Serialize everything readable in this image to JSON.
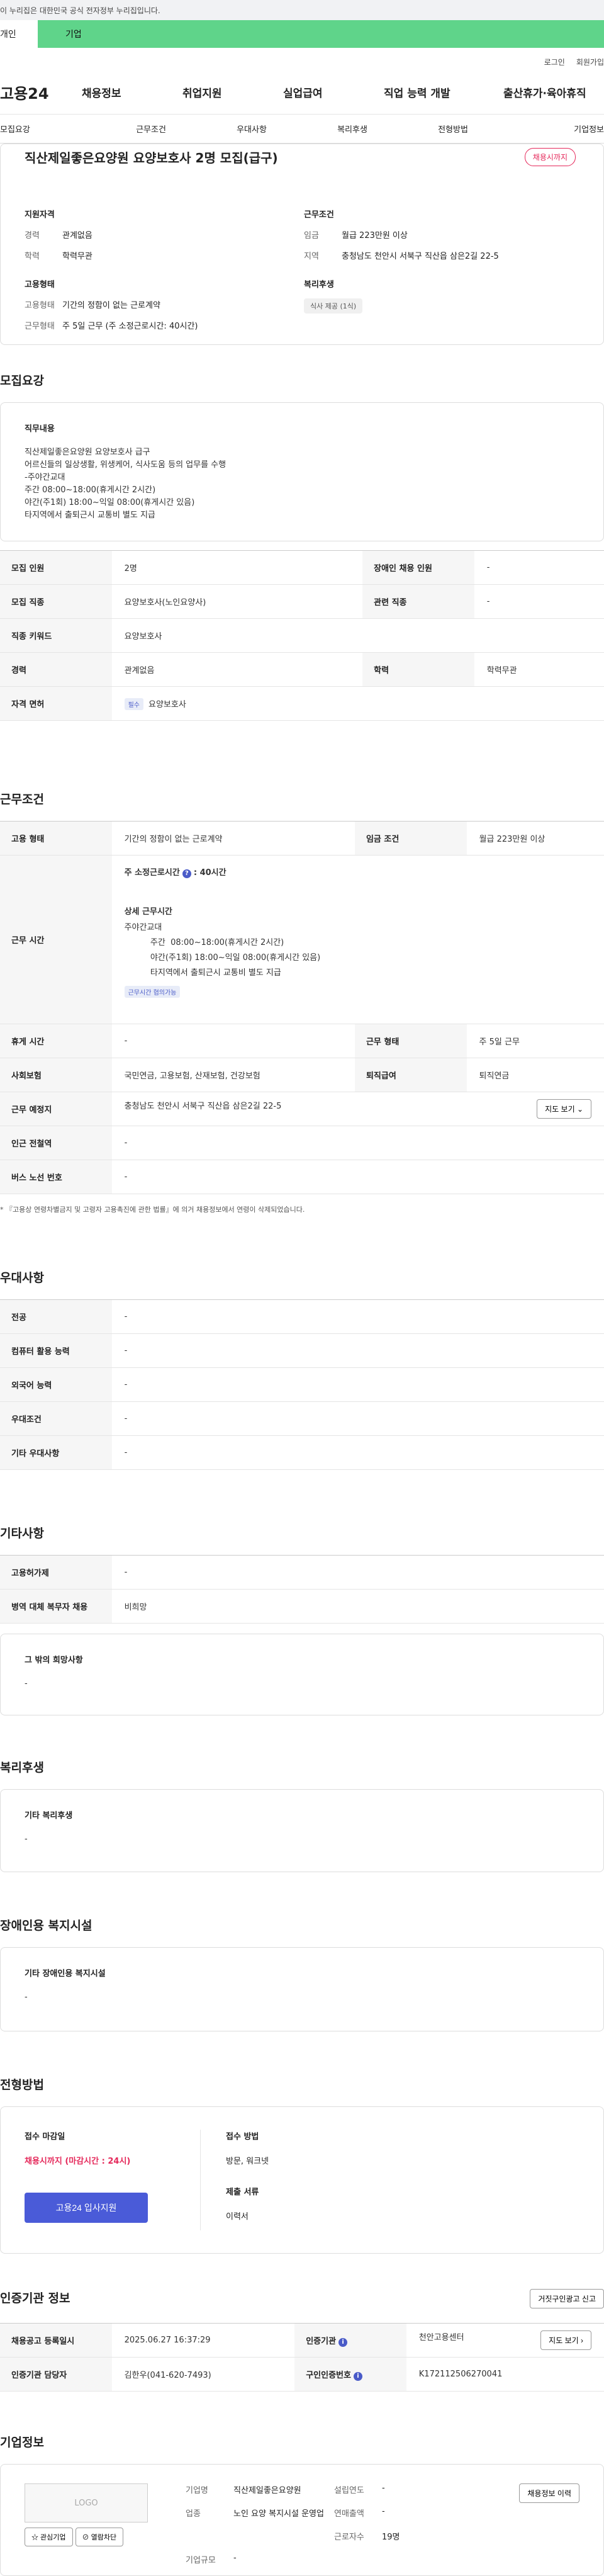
{
  "gov_banner": "이 누리집은 대한민국 공식 전자정부 누리집입니다.",
  "tabs": {
    "personal": "개인",
    "company": "기업"
  },
  "util": {
    "login": "로그인",
    "signup": "회원가입"
  },
  "logo": "고용24",
  "gnb": [
    "채용정보",
    "취업지원",
    "실업급여",
    "직업 능력 개발",
    "출산휴가·육아휴직"
  ],
  "anchor_nav": [
    "모집요강",
    "근무조건",
    "우대사항",
    "복리후생",
    "전형방법",
    "기업정보"
  ],
  "summary": {
    "title": "직산제일좋은요양원 요양보호사 2명 모집(급구)",
    "deadline_badge": "채용시까지",
    "qual_head": "지원자격",
    "career_k": "경력",
    "career_v": "관계없음",
    "edu_k": "학력",
    "edu_v": "학력무관",
    "cond_head": "근무조건",
    "wage_k": "임금",
    "wage_v": "월급 223만원 이상",
    "region_k": "지역",
    "region_v": "충청남도 천안시 서북구 직산읍 삼은2길 22-5",
    "emp_head": "고용형태",
    "emp_type_k": "고용형태",
    "emp_type_v": "기간의 정함이 없는 근로계약",
    "work_k": "근무형태",
    "work_v": "주 5일 근무 (주 소정근로시간: 40시간)",
    "benefit_head": "복리후생",
    "benefit_chip": "식사 제공 (1식)"
  },
  "recruit": {
    "title": "모집요강",
    "duty_head": "직무내용",
    "duty_text": "직산제일좋은요양원  요양보호사 급구\n 어르신들의 일상생활, 위생케어, 식사도움 등의 업무를 수행\n  -주야간교대\n  주간  08:00~18:00(휴게시간 2시간)\n  야간(주1회) 18:00~익일 08:00(휴게시간 있음)\n  타지역에서 출퇴근시 교통비 별도 지급",
    "rows": {
      "count_k": "모집 인원",
      "count_v": "2명",
      "disabled_k": "장애인 채용 인원",
      "disabled_v": "-",
      "job_k": "모집 직종",
      "job_v": "요양보호사(노인요양사)",
      "related_k": "관련 직종",
      "related_v": "-",
      "keyword_k": "직종 키워드",
      "keyword_v": "요양보호사",
      "career_k": "경력",
      "career_v": "관계없음",
      "edu_k": "학력",
      "edu_v": "학력무관",
      "license_k": "자격 면허",
      "license_badge": "필수",
      "license_v": "요양보호사"
    }
  },
  "conditions": {
    "title": "근무조건",
    "emp_k": "고용 형태",
    "emp_v": "기간의 정함이 없는 근로계약",
    "wage_k": "임금 조건",
    "wage_v": "월급 223만원 이상",
    "hours_k": "근무 시간",
    "hours_label": "주 소정근로시간",
    "hours_value": ": 40시간",
    "detail_head": "상세 근무시간",
    "detail_text": "주야간교대\n          주간  08:00~18:00(휴게시간 2시간)\n          야간(주1회) 18:00~익일 08:00(휴게시간 있음)\n          타지역에서 출퇴근시 교통비 별도 지급",
    "flex_badge": "근무시간 협의가능",
    "break_k": "휴게 시간",
    "break_v": "-",
    "worktype_k": "근무 형태",
    "worktype_v": "주 5일 근무",
    "insurance_k": "사회보험",
    "insurance_v": "국민연금, 고용보험, 산재보험, 건강보험",
    "severance_k": "퇴직급여",
    "severance_v": "퇴직연금",
    "place_k": "근무 예정지",
    "place_v": "충청남도 천안시 서북구 직산읍 삼은2길 22-5",
    "map_btn": "지도 보기 ⌄",
    "station_k": "인근 전철역",
    "station_v": "-",
    "bus_k": "버스 노선 번호",
    "bus_v": "-",
    "note": "* 『고용상 연령차별금지 및 고령자 고용촉진에 관한 법률』에 의거 채용정보에서 연령이 삭제되었습니다."
  },
  "preference": {
    "title": "우대사항",
    "major_k": "전공",
    "major_v": "-",
    "computer_k": "컴퓨터 활용 능력",
    "computer_v": "-",
    "language_k": "외국어 능력",
    "language_v": "-",
    "pref_k": "우대조건",
    "pref_v": "-",
    "etc_k": "기타 우대사항",
    "etc_v": "-"
  },
  "etc": {
    "title": "기타사항",
    "permit_k": "고용허가제",
    "permit_v": "-",
    "military_k": "병역 대체 복무자 채용",
    "military_v": "비희망",
    "other_head": "그 밖의 희망사항",
    "other_v": "-"
  },
  "welfare": {
    "title": "복리후생",
    "head": "기타 복리후생",
    "value": "-"
  },
  "facility": {
    "title": "장애인용 복지시설",
    "head": "기타 장애인용 복지시설",
    "value": "-"
  },
  "process": {
    "title": "전형방법",
    "deadline_head": "접수 마감일",
    "deadline_v": "채용시까지 (마감시간 : 24시)",
    "apply_btn": "고용24 입사지원",
    "method_head": "접수 방법",
    "method_v": "방문, 워크넷",
    "docs_head": "제출 서류",
    "docs_v": "이력서"
  },
  "agency": {
    "title": "인증기관 정보",
    "report_btn": "거짓구인광고 신고",
    "reg_k": "채용공고 등록일시",
    "reg_v": "2025.06.27 16:37:29",
    "agency_k": "인증기관",
    "agency_v": "천안고용센터",
    "map_btn": "지도 보기 ›",
    "manager_k": "인증기관 담당자",
    "manager_v": "김한우(041-620-7493)",
    "reqno_k": "구인인증번호",
    "reqno_v": "K172112506270041"
  },
  "company": {
    "title": "기업정보",
    "logo_text": "LOGO",
    "fav_btn": "☆ 관심기업",
    "block_btn": "⊘ 열람차단",
    "name_k": "기업명",
    "name_v": "직산제일좋은요양원",
    "founded_k": "설립연도",
    "founded_v": "-",
    "industry_k": "업종",
    "industry_v": "노인 요양 복지시설 운영업",
    "sales_k": "연매출액",
    "sales_v": "-",
    "employees_k": "근로자수",
    "employees_v": "19명",
    "size_k": "기업규모",
    "size_v": "-",
    "history_btn": "채용정보 이력"
  }
}
